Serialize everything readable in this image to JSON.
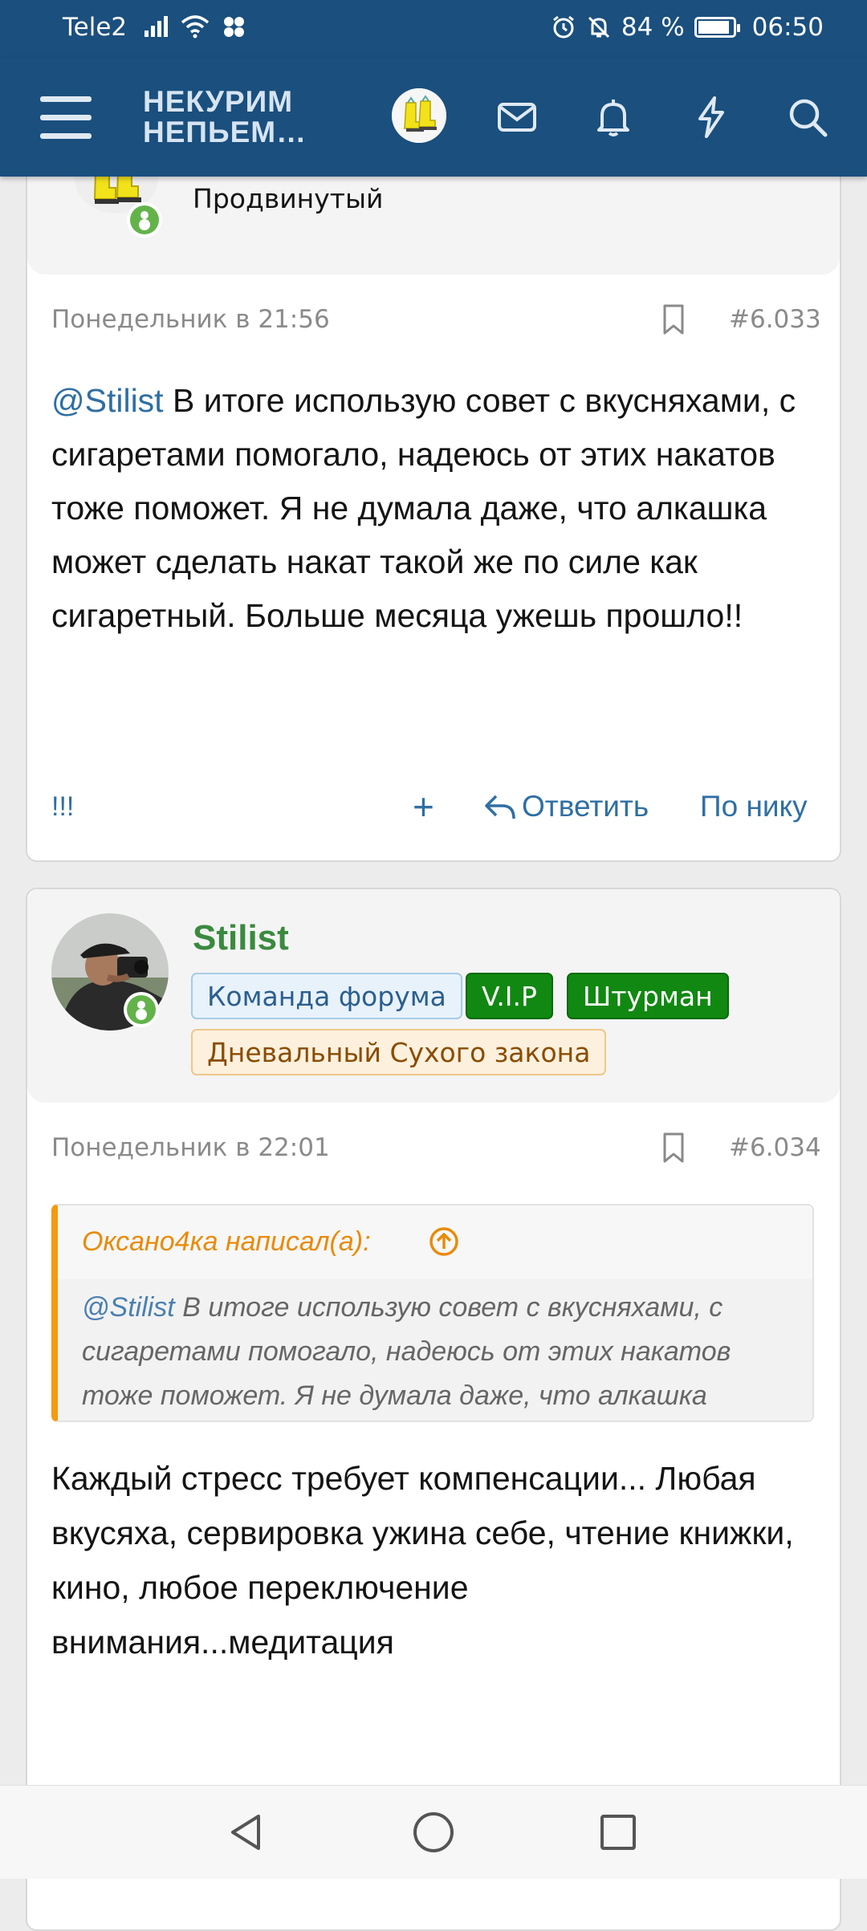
{
  "status_bar": {
    "carrier": "Tele2",
    "battery_percent": "84 %",
    "battery_level": 0.84,
    "time": "06:50",
    "icons": [
      "signal-icon",
      "wifi-icon",
      "social-icon",
      "alarm-icon",
      "mute-icon",
      "battery-icon"
    ]
  },
  "header": {
    "logo_line1": "НЕКУРИМ",
    "logo_line2": "НЕПЬЕМ…",
    "icons": [
      "menu-icon",
      "user-avatar",
      "mail-icon",
      "bell-icon",
      "lightning-icon",
      "search-icon"
    ]
  },
  "posts": [
    {
      "user_title": "Продвинутый",
      "date": "Понедельник в 21:56",
      "number": "#6.033",
      "mention": "@Stilist",
      "message": " В итоге использую совет с вкусняхами, с сигаретами помогало, надеюсь от этих накатов тоже поможет. Я не думала даже, что алкашка может сделать накат такой же по силе как сигаретный. Больше месяца ужешь прошло!!",
      "actions": {
        "reactions": "!!!",
        "plus": "+",
        "reply": "Ответить",
        "by_nick": "По нику"
      }
    },
    {
      "username": "Stilist",
      "badges": [
        "Команда форума",
        "V.I.P",
        "Штурман",
        "Дневальный Сухого закона"
      ],
      "date": "Понедельник в 22:01",
      "number": "#6.034",
      "quote": {
        "author": "Оксано4ка написал(а):",
        "mention": "@Stilist",
        "text": " В итоге использую совет с вкусняхами, с сигаретами помогало, надеюсь от этих накатов тоже поможет. Я не думала даже, что алкашка может сделать накат такой же по силе как сигаретный. Больше месяца ужешь прошло!!"
      },
      "message": "Каждый стресс требует компенсации... Любая вкусяха, сервировка ужина себе, чтение книжки, кино, любое переключение внимания...медитация"
    }
  ],
  "nav": {
    "buttons": [
      "back-icon",
      "home-icon",
      "recents-icon"
    ]
  },
  "colors": {
    "header_bg": "#1a4f7e",
    "link": "#2f6fa3",
    "username": "#3a8a3f",
    "quote_accent": "#f39a10",
    "online": "#63b34a"
  }
}
